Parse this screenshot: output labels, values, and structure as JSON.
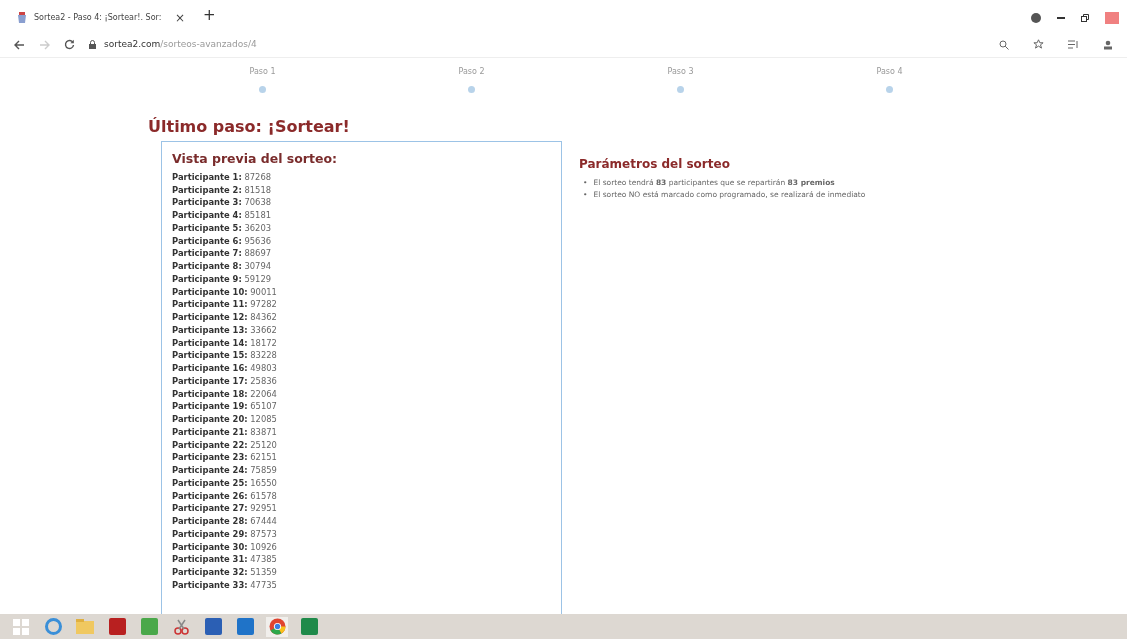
{
  "browser": {
    "tab_title": "Sortea2 - Paso 4: ¡Sortear!. Sor:",
    "tab_close": "×",
    "new_tab": "+",
    "url_domain": "sortea2.com",
    "url_path": "/sorteos-avanzados/4"
  },
  "steps": [
    {
      "label": "Paso 1"
    },
    {
      "label": "Paso 2"
    },
    {
      "label": "Paso 3"
    },
    {
      "label": "Paso 4"
    }
  ],
  "heading": "Último paso: ¡Sortear!",
  "preview": {
    "title": "Vista previa del sorteo:",
    "participants": [
      {
        "label": "Participante 1:",
        "value": "87268"
      },
      {
        "label": "Participante 2:",
        "value": "81518"
      },
      {
        "label": "Participante 3:",
        "value": "70638"
      },
      {
        "label": "Participante 4:",
        "value": "85181"
      },
      {
        "label": "Participante 5:",
        "value": "36203"
      },
      {
        "label": "Participante 6:",
        "value": "95636"
      },
      {
        "label": "Participante 7:",
        "value": "88697"
      },
      {
        "label": "Participante 8:",
        "value": "30794"
      },
      {
        "label": "Participante 9:",
        "value": "59129"
      },
      {
        "label": "Participante 10:",
        "value": "90011"
      },
      {
        "label": "Participante 11:",
        "value": "97282"
      },
      {
        "label": "Participante 12:",
        "value": "84362"
      },
      {
        "label": "Participante 13:",
        "value": "33662"
      },
      {
        "label": "Participante 14:",
        "value": "18172"
      },
      {
        "label": "Participante 15:",
        "value": "83228"
      },
      {
        "label": "Participante 16:",
        "value": "49803"
      },
      {
        "label": "Participante 17:",
        "value": "25836"
      },
      {
        "label": "Participante 18:",
        "value": "22064"
      },
      {
        "label": "Participante 19:",
        "value": "65107"
      },
      {
        "label": "Participante 20:",
        "value": "12085"
      },
      {
        "label": "Participante 21:",
        "value": "83871"
      },
      {
        "label": "Participante 22:",
        "value": "25120"
      },
      {
        "label": "Participante 23:",
        "value": "62151"
      },
      {
        "label": "Participante 24:",
        "value": "75859"
      },
      {
        "label": "Participante 25:",
        "value": "16550"
      },
      {
        "label": "Participante 26:",
        "value": "61578"
      },
      {
        "label": "Participante 27:",
        "value": "92951"
      },
      {
        "label": "Participante 28:",
        "value": "67444"
      },
      {
        "label": "Participante 29:",
        "value": "87573"
      },
      {
        "label": "Participante 30:",
        "value": "10926"
      },
      {
        "label": "Participante 31:",
        "value": "47385"
      },
      {
        "label": "Participante 32:",
        "value": "51359"
      },
      {
        "label": "Participante 33:",
        "value": "47735"
      }
    ]
  },
  "parameters": {
    "title": "Parámetros del sorteo",
    "items": [
      {
        "bullet": "•",
        "text": "El sorteo tendrá **83** participantes que se repartirán **83 premios**"
      },
      {
        "bullet": "•",
        "text": "El sorteo NO está marcado como programado, se realizará de inmediato"
      }
    ]
  },
  "taskbar": [
    {
      "kind": "start",
      "selected": false
    },
    {
      "kind": "browser-e",
      "selected": false
    },
    {
      "kind": "folder",
      "selected": false
    },
    {
      "kind": "pdf",
      "selected": false
    },
    {
      "kind": "calculator",
      "selected": false
    },
    {
      "kind": "scissors",
      "selected": false
    },
    {
      "kind": "word",
      "selected": false
    },
    {
      "kind": "outlook",
      "selected": false
    },
    {
      "kind": "chrome",
      "selected": true
    },
    {
      "kind": "excel",
      "selected": false
    }
  ]
}
